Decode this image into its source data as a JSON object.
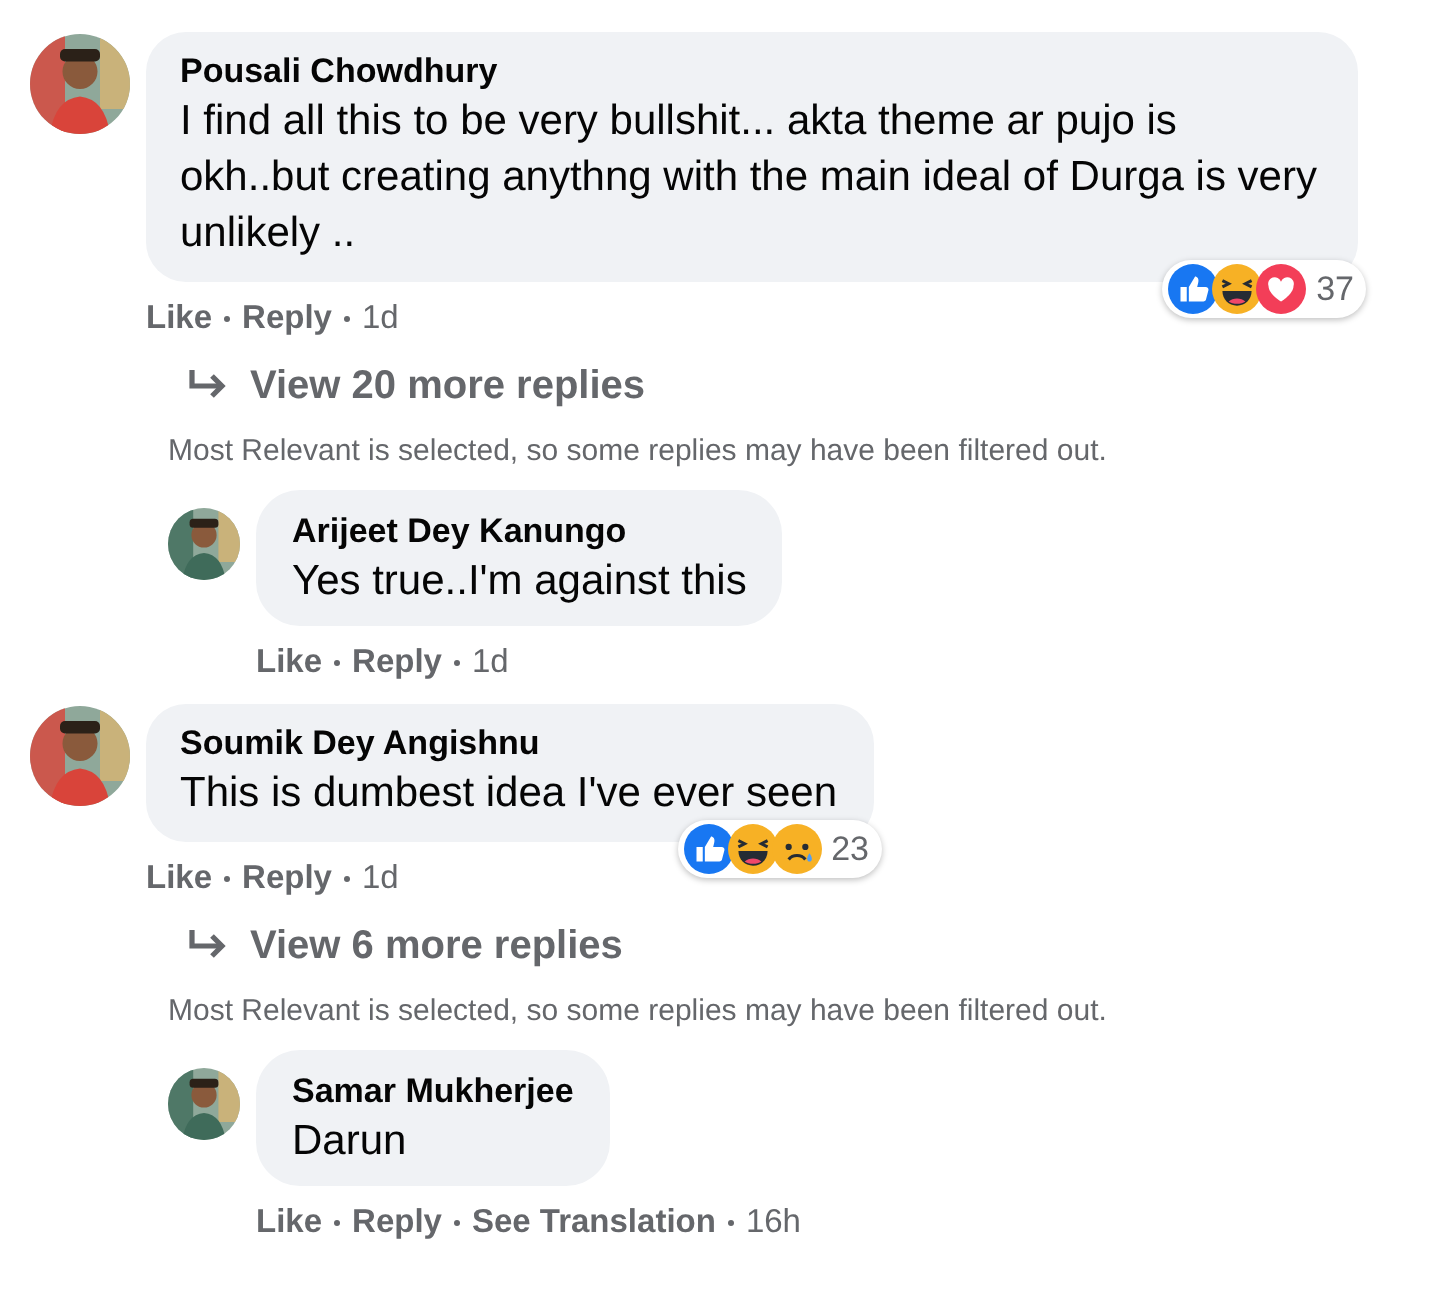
{
  "thread": [
    {
      "kind": "comment",
      "author": "Pousali Chowdhury",
      "text": "I find all this to be very bullshit... akta theme ar pujo is okh..but creating anythng with the main ideal of Durga is very unlikely ..",
      "reactions": [
        {
          "kind": "like"
        },
        {
          "kind": "haha"
        },
        {
          "kind": "love"
        }
      ],
      "reaction_count": "37",
      "actions": [
        "Like",
        "Reply"
      ],
      "time": "1d"
    },
    {
      "kind": "more",
      "label": "View 20 more replies"
    },
    {
      "kind": "note",
      "text": "Most Relevant is selected, so some replies may have been filtered out."
    },
    {
      "kind": "reply",
      "author": "Arijeet Dey Kanungo",
      "text": "Yes true..I'm against this",
      "actions": [
        "Like",
        "Reply"
      ],
      "time": "1d"
    },
    {
      "kind": "comment",
      "author": "Soumik Dey Angishnu",
      "text": "This is dumbest idea I've ever seen",
      "reactions": [
        {
          "kind": "like"
        },
        {
          "kind": "haha"
        },
        {
          "kind": "sad"
        }
      ],
      "reaction_count": "23",
      "actions": [
        "Like",
        "Reply"
      ],
      "time": "1d"
    },
    {
      "kind": "more",
      "label": "View 6 more replies"
    },
    {
      "kind": "note",
      "text": "Most Relevant is selected, so some replies may have been filtered out."
    },
    {
      "kind": "reply",
      "author": "Samar Mukherjee",
      "text": "Darun",
      "actions": [
        "Like",
        "Reply",
        "See Translation"
      ],
      "time": "16h"
    }
  ]
}
